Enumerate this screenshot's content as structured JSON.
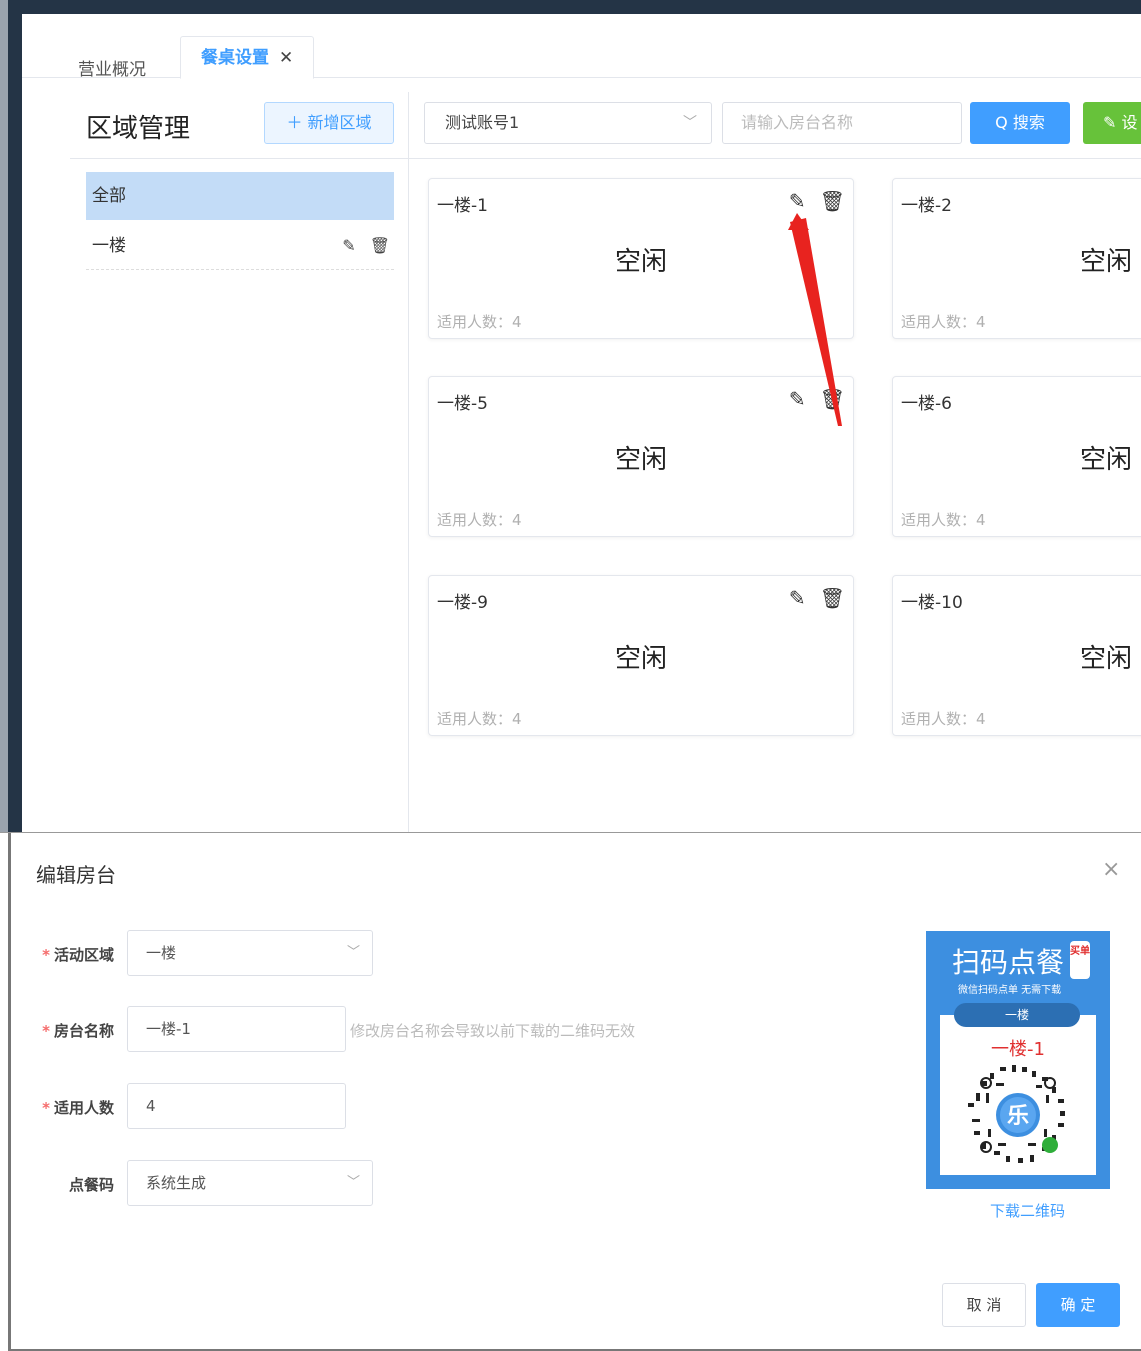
{
  "tabs": [
    {
      "label": "营业概况"
    },
    {
      "label": "餐桌设置",
      "close": "✕"
    }
  ],
  "sidebar": {
    "title": "区域管理",
    "add_button": "＋ 新增区域",
    "items": [
      {
        "label": "全部"
      },
      {
        "label": "一楼"
      }
    ]
  },
  "toolbar": {
    "account_select": "测试账号1",
    "search_placeholder": "请输入房台名称",
    "search_button": "Q 搜索",
    "set_button": "✎ 设"
  },
  "cards": [
    {
      "name": "一楼-1",
      "status": "空闲",
      "capacity": "适用人数：4"
    },
    {
      "name": "一楼-2",
      "status": "空闲",
      "capacity": "适用人数：4"
    },
    {
      "name": "一楼-5",
      "status": "空闲",
      "capacity": "适用人数：4"
    },
    {
      "name": "一楼-6",
      "status": "空闲",
      "capacity": "适用人数：4"
    },
    {
      "name": "一楼-9",
      "status": "空闲",
      "capacity": "适用人数：4"
    },
    {
      "name": "一楼-10",
      "status": "空闲",
      "capacity": "适用人数：4"
    }
  ],
  "dialog": {
    "title": "编辑房台",
    "close": "×",
    "fields": {
      "area_label": "活动区域",
      "area_value": "一楼",
      "name_label": "房台名称",
      "name_value": "一楼-1",
      "name_hint": "修改房台名称会导致以前下载的二维码无效",
      "capacity_label": "适用人数",
      "capacity_value": "4",
      "code_label": "点餐码",
      "code_value": "系统生成",
      "required_mark": "*"
    },
    "qr": {
      "title": "扫码点餐",
      "badge": "买单",
      "subtitle": "微信扫码点单  无需下载",
      "area": "一楼",
      "table": "一楼-1",
      "download": "下载二维码"
    },
    "cancel": "取 消",
    "confirm": "确 定"
  },
  "colors": {
    "primary": "#409eff",
    "success": "#67c23a",
    "danger": "#f56c6c",
    "nav_dark": "#243446",
    "qr_blue": "#3d8fe0"
  }
}
